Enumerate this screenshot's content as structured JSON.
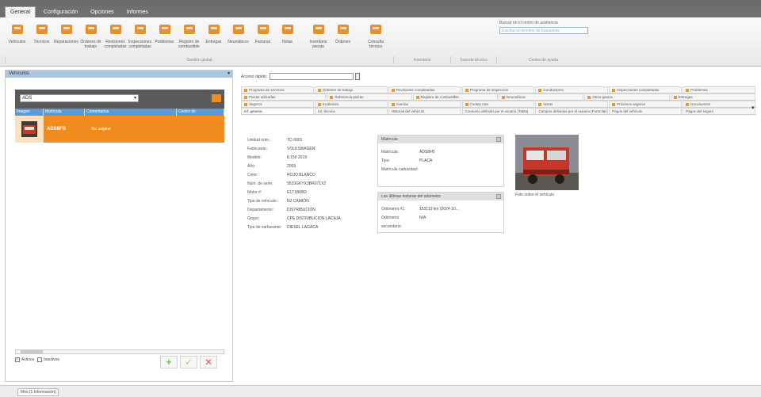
{
  "menu": {
    "tabs": [
      "General",
      "Configuración",
      "Opciones",
      "Informes"
    ]
  },
  "ribbon": {
    "buttons": [
      {
        "label": "Vehículos",
        "icon": "car-icon"
      },
      {
        "label": "Técnicos",
        "icon": "people-icon"
      },
      {
        "label": "Reparaciones",
        "icon": "warning-icon"
      },
      {
        "label": "Órdenes de trabajo",
        "icon": "worker-icon"
      },
      {
        "label": "Revisiones completadas",
        "icon": "edit-icon"
      },
      {
        "label": "Inspecciones completadas",
        "icon": "clipboard-icon"
      },
      {
        "label": "Problemas",
        "icon": "alert-icon"
      },
      {
        "label": "Registro de combustible",
        "icon": "fuel-icon"
      },
      {
        "label": "Entregas",
        "icon": "truck-icon"
      },
      {
        "label": "Neumáticos",
        "icon": "tire-icon"
      },
      {
        "label": "Facturas",
        "icon": "invoice-icon"
      },
      {
        "label": "Notas",
        "icon": "notes-icon"
      },
      {
        "label": "Inventario piezas",
        "icon": "parts-icon"
      },
      {
        "label": "Órdenes",
        "icon": "tools-icon"
      },
      {
        "label": "Consulta técnica",
        "icon": "help-icon"
      }
    ],
    "groups": [
      "Gestión global",
      "Inventario",
      "Soporte técnico",
      "Centro de ayuda"
    ],
    "search": {
      "caption": "Buscar en el centro de asistencia",
      "placeholder": "Escriba un término de búsqueda"
    }
  },
  "left_pane": {
    "title": "Vehículos",
    "filter_value": "ADS",
    "columns": [
      "Imagen",
      "Matrícula",
      "Comentarios",
      "Centro de"
    ],
    "rows": [
      {
        "plate": "ADS8FB",
        "extra": "Sin asignar"
      }
    ],
    "checks": [
      {
        "label": "Activos",
        "checked": true
      },
      {
        "label": "Inactivos",
        "checked": false
      }
    ],
    "buttons": {
      "add": "+",
      "edit": "✓",
      "delete": "✕"
    }
  },
  "quick_access": {
    "label": "Acceso rápido:"
  },
  "tabs": {
    "row1": [
      "Programa de servicios",
      "Órdenes de trabajo",
      "Revisiones completadas",
      "Programa de inspección",
      "Conductores",
      "Inspecciones completadas",
      "Problemas"
    ],
    "row2": [
      "Piezas utilizadas",
      "Referencia piezas",
      "Registro de combustible",
      "Neumáticos",
      "Otros gastos",
      "Entregas"
    ],
    "row3": [
      "Seguros",
      "Incidentes",
      "Averías",
      "Cuotas ruta",
      "Notas",
      "Próximos seguros",
      "Documentos"
    ],
    "row4": [
      "Inf. general",
      "Inf. técnica",
      "Historial del vehículo",
      "Consumo definido por el usuario (Tabla)",
      "Campos definidos por el usuario (Formulario)",
      "Pagos del vehículo",
      "Pagos del seguro"
    ]
  },
  "properties": [
    {
      "key": "Unidad núm.:",
      "value": "TC-0001"
    },
    {
      "key": "Fabricante:",
      "value": "VOLKSWAGEN"
    },
    {
      "key": "Modelo:",
      "value": "8.150 2019"
    },
    {
      "key": "Año:",
      "value": "2009"
    },
    {
      "key": "Color:",
      "value": "ROJO BLANCO"
    },
    {
      "key": "Núm. de serie:",
      "value": "9533GKYX3BR071X2"
    },
    {
      "key": "Motor #:",
      "value": "E1T1B6BD"
    },
    {
      "key": "Tipo de vehículo:",
      "value": "N2 CAMIÓN"
    },
    {
      "key": "Departamento:",
      "value": "DISTRIBUCIÓN"
    },
    {
      "key": "Grupo:",
      "value": "CPE DISTRIBUCION LACAJA"
    },
    {
      "key": "Tipo de carburante:",
      "value": "DIESEL LAGACA"
    }
  ],
  "plate_panel": {
    "title": "Matrícula",
    "rows": [
      {
        "key": "Matrícula:",
        "value": "ADS8FB"
      },
      {
        "key": "Tipo:",
        "value": "PLACA"
      },
      {
        "key": "Matrícula caducidad:",
        "value": ""
      }
    ]
  },
  "odometer_panel": {
    "title": "Las últimas lecturas del odómetro",
    "rows": [
      {
        "key": "Odómetro #1:",
        "value": "153113 km (2024-10..."
      },
      {
        "key": "Odómetro secundario:",
        "value": "N/A"
      }
    ]
  },
  "photo": {
    "caption": "Foto sobre el vehículo"
  },
  "status_bar": {
    "tab": "Mes (1 Información)"
  },
  "colors": {
    "accent": "#f08c1e",
    "header_blue": "#5b9bd5"
  }
}
